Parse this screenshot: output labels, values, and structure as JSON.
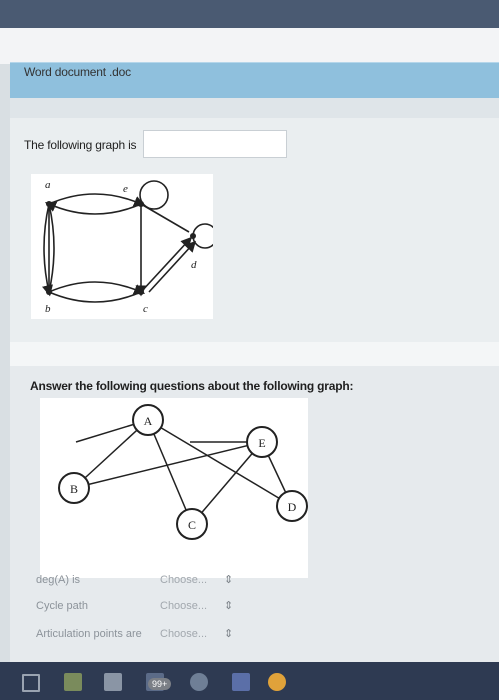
{
  "document": {
    "title": "Word document .doc"
  },
  "question1": {
    "prompt": "The following graph is",
    "graph_labels": [
      "a",
      "e",
      "d",
      "b",
      "c"
    ]
  },
  "question2": {
    "prompt": "Answer the following questions about the following graph:",
    "graph_labels": [
      "A",
      "E",
      "B",
      "D",
      "C"
    ],
    "rows": [
      {
        "label": "deg(A) is",
        "select": "Choose..."
      },
      {
        "label": "Cycle path",
        "select": "Choose..."
      },
      {
        "label": "Articulation points are",
        "select": "Choose..."
      }
    ]
  },
  "taskbar": {
    "badge": "99+"
  },
  "colors": {
    "doc_bar": "#8fc0dd",
    "taskbar": "#2e3a52"
  }
}
